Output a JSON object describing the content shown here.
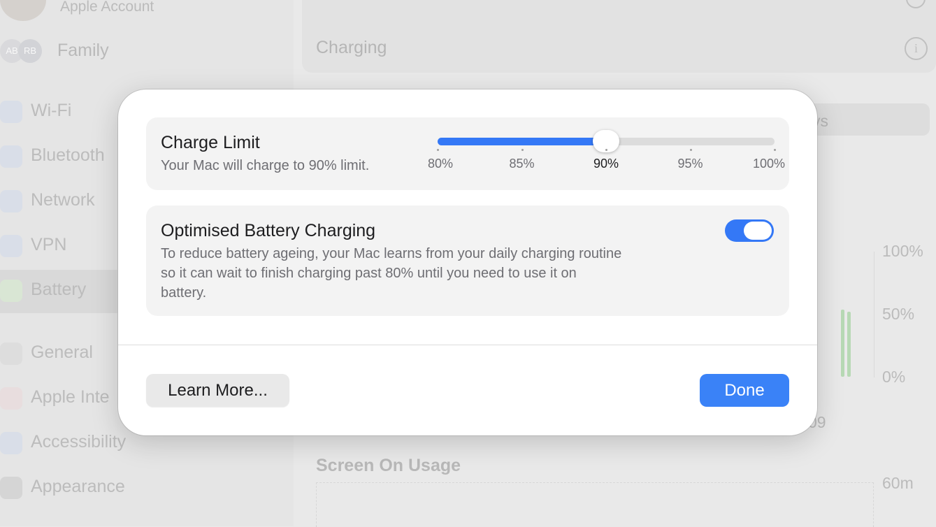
{
  "sidebar": {
    "account_label": "Apple Account",
    "family_initials": [
      "AB",
      "RB"
    ],
    "family_label": "Family",
    "items": [
      {
        "label": "Wi-Fi",
        "icon": "wifi-icon"
      },
      {
        "label": "Bluetooth",
        "icon": "bluetooth-icon"
      },
      {
        "label": "Network",
        "icon": "globe-icon"
      },
      {
        "label": "VPN",
        "icon": "globe-icon"
      },
      {
        "label": "Battery",
        "icon": "battery-icon",
        "selected": true
      },
      {
        "label": "General",
        "icon": "gear-icon"
      },
      {
        "label": "Apple Inte",
        "icon": "apple-intelligence-icon"
      },
      {
        "label": "Accessibility",
        "icon": "accessibility-icon"
      },
      {
        "label": "Appearance",
        "icon": "appearance-icon"
      }
    ]
  },
  "background": {
    "charging_label": "Charging",
    "segment_text": "ys",
    "battery_axis": [
      "100%",
      "50%",
      "0%"
    ],
    "time_label": "09",
    "usage_title": "Screen On Usage",
    "usage_axis": "60m"
  },
  "dialog": {
    "charge_limit": {
      "title": "Charge Limit",
      "subtitle": "Your Mac will charge to 90% limit.",
      "ticks": [
        "80%",
        "85%",
        "90%",
        "95%",
        "100%"
      ],
      "value_percent": 90,
      "min": 80,
      "max": 100
    },
    "optimised": {
      "title": "Optimised Battery Charging",
      "description_lines": [
        "To reduce battery ageing, your Mac learns from your daily charging routine",
        "so it can wait to finish charging past 80% until you need to use it on",
        "battery."
      ],
      "enabled": true
    },
    "buttons": {
      "learn_more": "Learn More...",
      "done": "Done"
    }
  },
  "colors": {
    "accent": "#3478f6",
    "done_button": "#3a82f7"
  }
}
